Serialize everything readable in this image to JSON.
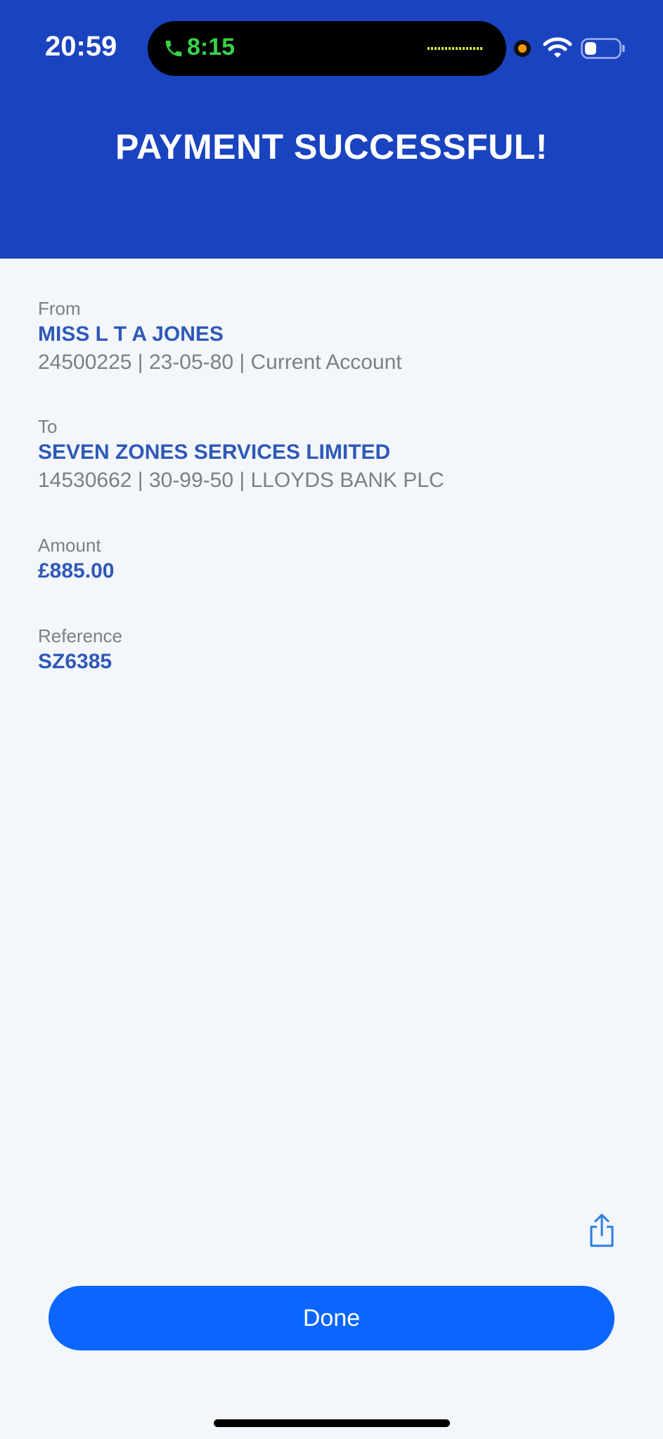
{
  "status_bar": {
    "time": "20:59",
    "call_time": "8:15"
  },
  "header": {
    "title": "PAYMENT SUCCESSFUL!",
    "background": "#1a43c0"
  },
  "from": {
    "label": "From",
    "name": "MISS L T A JONES",
    "detail": "24500225 | 23-05-80 | Current Account"
  },
  "to": {
    "label": "To",
    "name": "SEVEN ZONES SERVICES LIMITED",
    "detail": "14530662 | 30-99-50 | LLOYDS BANK PLC"
  },
  "amount": {
    "label": "Amount",
    "value": "£885.00"
  },
  "reference": {
    "label": "Reference",
    "value": "SZ6385"
  },
  "actions": {
    "share_icon": "share-icon",
    "done_label": "Done",
    "accent": "#0a66ff"
  }
}
